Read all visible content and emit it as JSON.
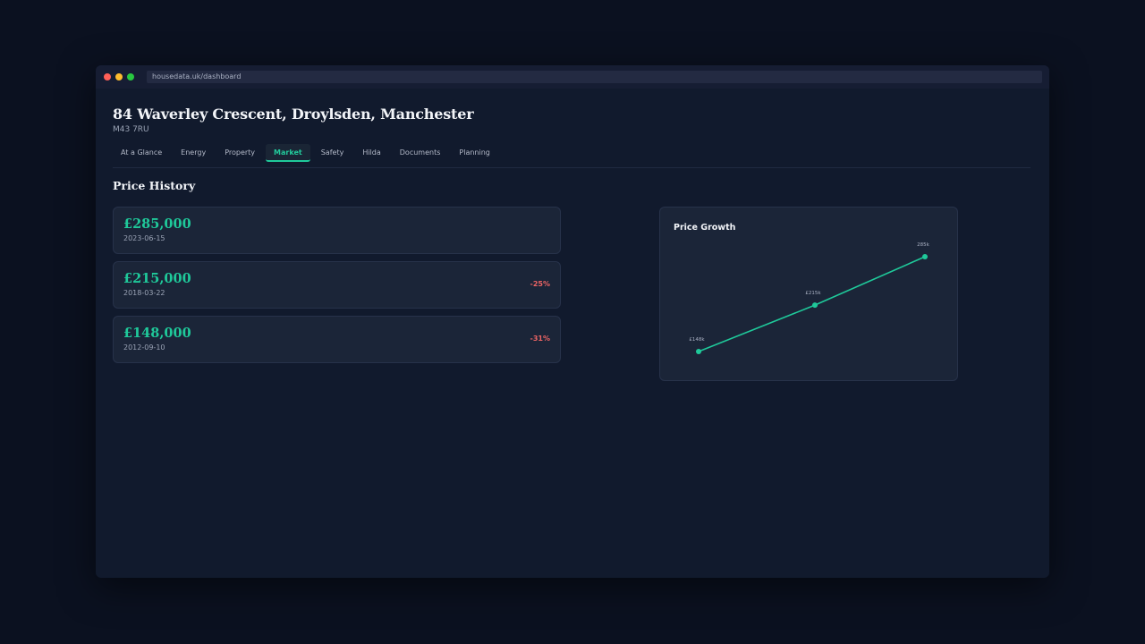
{
  "window": {
    "url": "housedata.uk/dashboard"
  },
  "property": {
    "address": "84 Waverley Crescent, Droylsden, Manchester",
    "postcode": "M43 7RU"
  },
  "tabs": [
    {
      "label": "At a Glance",
      "active": false
    },
    {
      "label": "Energy",
      "active": false
    },
    {
      "label": "Property",
      "active": false
    },
    {
      "label": "Market",
      "active": true
    },
    {
      "label": "Safety",
      "active": false
    },
    {
      "label": "Hilda",
      "active": false
    },
    {
      "label": "Documents",
      "active": false
    },
    {
      "label": "Planning",
      "active": false
    }
  ],
  "price_history": {
    "title": "Price History",
    "entries": [
      {
        "price": "£285,000",
        "date": "2023-06-15",
        "change": ""
      },
      {
        "price": "£215,000",
        "date": "2018-03-22",
        "change": "-25%"
      },
      {
        "price": "£148,000",
        "date": "2012-09-10",
        "change": "-31%"
      }
    ]
  },
  "colors": {
    "accent": "#1fc99a",
    "negative": "#ec6464",
    "background": "#0b1120",
    "card": "#1b2538"
  },
  "chart_data": {
    "type": "line",
    "title": "Price Growth",
    "x": [
      "2012-09-10",
      "2018-03-22",
      "2023-06-15"
    ],
    "series": [
      {
        "values": [
          148000,
          215000,
          285000
        ]
      }
    ],
    "point_labels": [
      "£148k",
      "£215k",
      "285k"
    ],
    "grid": false,
    "xlabel": "",
    "ylabel": ""
  }
}
